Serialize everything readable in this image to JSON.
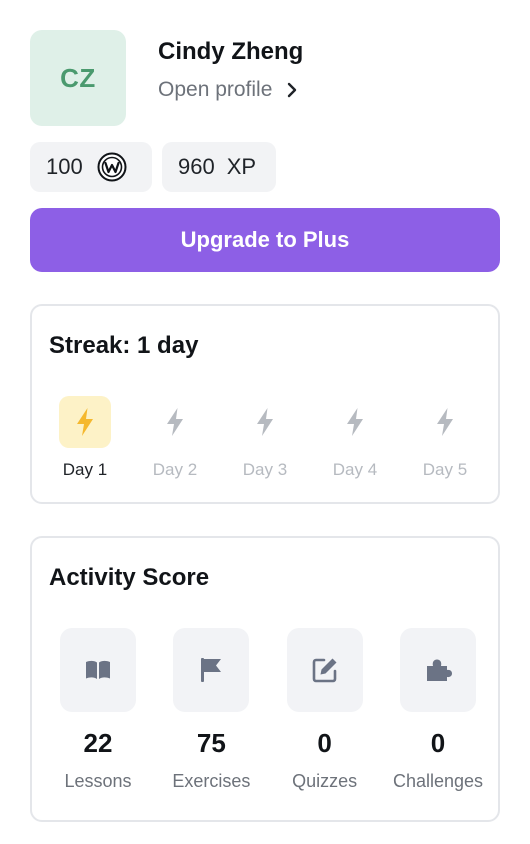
{
  "profile": {
    "initials": "CZ",
    "name": "Cindy Zheng",
    "link_label": "Open profile"
  },
  "chips": {
    "coins_value": "100",
    "xp_value": "960",
    "xp_unit": "XP"
  },
  "upgrade": {
    "label": "Upgrade to Plus"
  },
  "streak": {
    "title": "Streak: 1 day",
    "days": [
      {
        "label": "Day 1",
        "active": true
      },
      {
        "label": "Day 2",
        "active": false
      },
      {
        "label": "Day 3",
        "active": false
      },
      {
        "label": "Day 4",
        "active": false
      },
      {
        "label": "Day 5",
        "active": false
      }
    ]
  },
  "activity": {
    "title": "Activity Score",
    "stats": [
      {
        "value": "22",
        "label": "Lessons",
        "icon": "book-icon"
      },
      {
        "value": "75",
        "label": "Exercises",
        "icon": "flag-icon"
      },
      {
        "value": "0",
        "label": "Quizzes",
        "icon": "edit-icon"
      },
      {
        "value": "0",
        "label": "Challenges",
        "icon": "puzzle-icon"
      }
    ]
  },
  "colors": {
    "accent": "#8d5fe6",
    "avatar_bg": "#dff0e8",
    "avatar_text": "#4a9a6e",
    "streak_active": "#f5b82e",
    "streak_active_bg": "#fdf2c7",
    "streak_inactive": "#b6bac0",
    "icon_gray": "#6b7385"
  }
}
